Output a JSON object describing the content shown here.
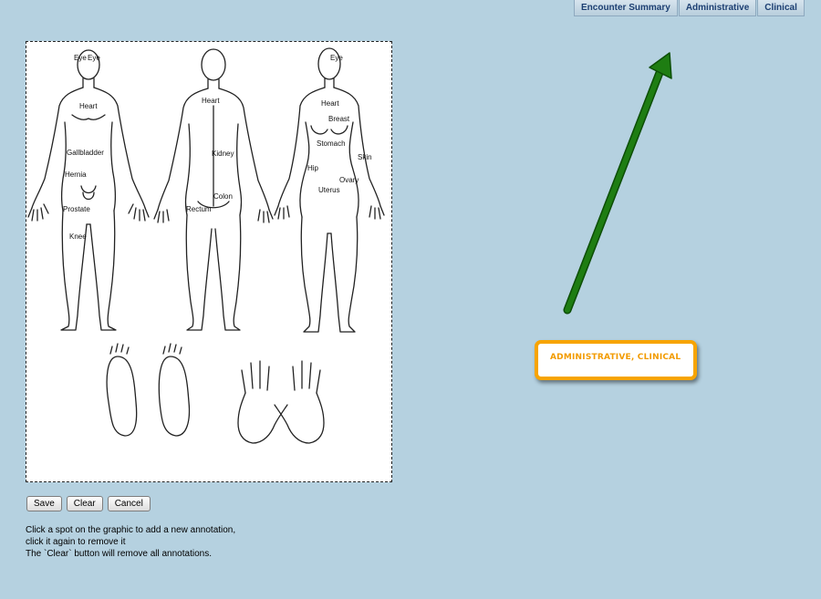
{
  "tabs": [
    "Encounter Summary",
    "Administrative",
    "Clinical"
  ],
  "diagram": {
    "labels": {
      "eye_left": "Eye",
      "eye_right": "Eye",
      "heart_front": "Heart",
      "gallbladder": "Gallbladder",
      "hernia": "Hernia",
      "prostate": "Prostate",
      "knee": "Knee",
      "heart_back": "Heart",
      "kidney": "Kidney",
      "colon": "Colon",
      "rectum": "Rectum",
      "eye_female": "Eye",
      "heart_female": "Heart",
      "breast": "Breast",
      "stomach": "Stomach",
      "skin": "Skin",
      "hip": "Hip",
      "ovary": "Ovary",
      "uterus": "Uterus"
    }
  },
  "buttons": {
    "save": "Save",
    "clear": "Clear",
    "cancel": "Cancel"
  },
  "instructions": {
    "line1": "Click a spot on the graphic to add a new annotation,",
    "line2": "click it again to remove it",
    "line3": "The `Clear` button will remove all annotations."
  },
  "callout": {
    "text": "Administrative, Clinical"
  },
  "colors": {
    "background": "#b5d1e0",
    "arrow": "#1e7d12",
    "callout_border": "#f7a400",
    "callout_text": "#f29b00",
    "tab_text": "#1d3f72"
  }
}
